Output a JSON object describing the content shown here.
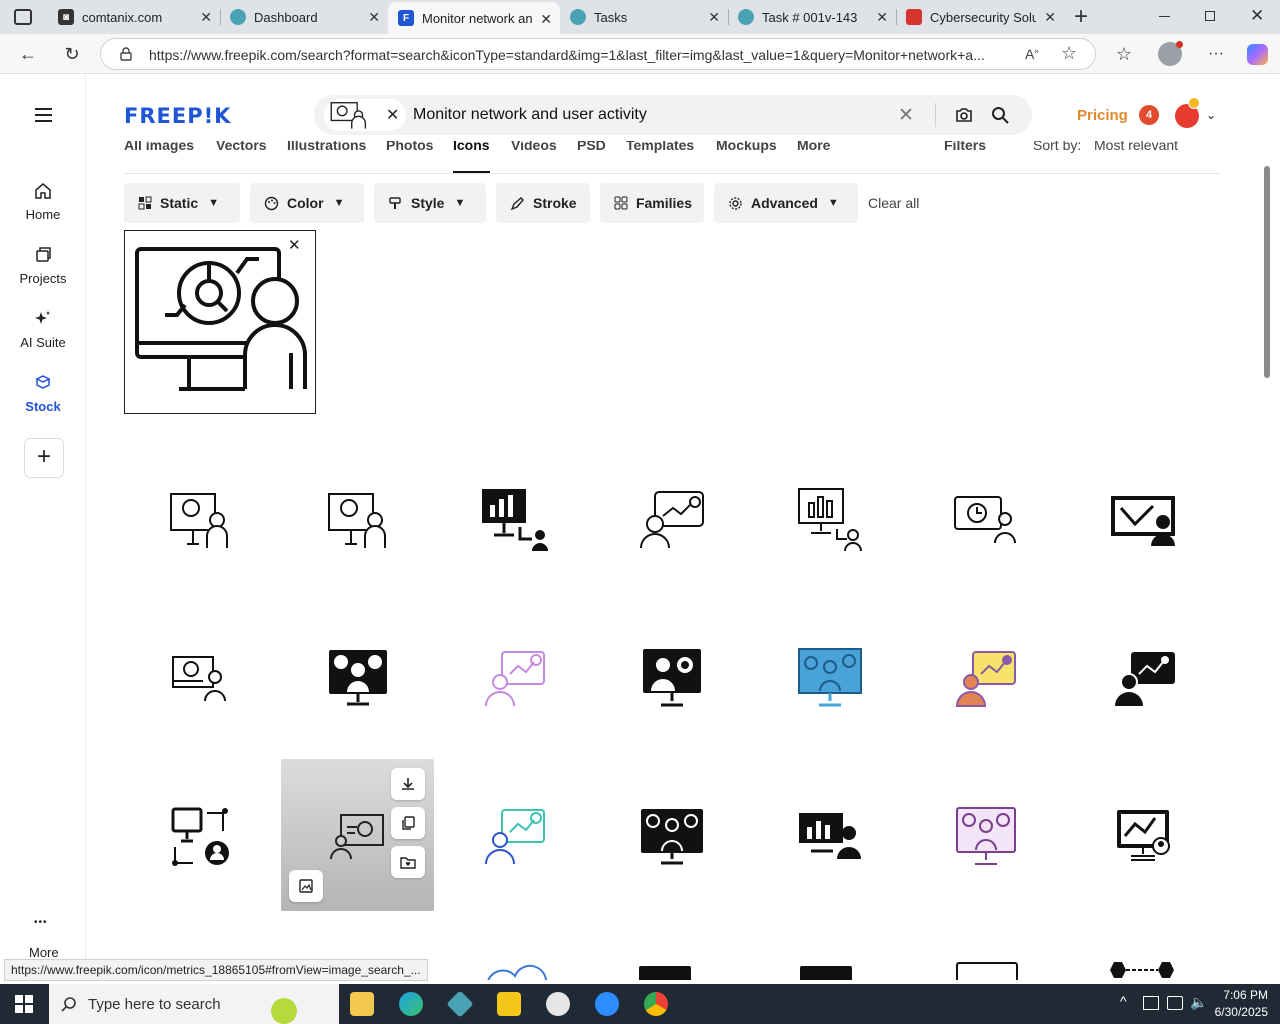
{
  "browser": {
    "tabs": [
      {
        "title": "comtanix.com"
      },
      {
        "title": "Dashboard"
      },
      {
        "title": "Monitor network and user activity"
      },
      {
        "title": "Tasks"
      },
      {
        "title": "Task # 001v-143"
      },
      {
        "title": "Cybersecurity Solutions"
      }
    ],
    "new_tab": "+",
    "url": "https://www.freepik.com/search?format=search&iconType=standard&img=1&last_filter=img&last_value=1&query=Monitor+network+a..."
  },
  "rail": {
    "items": [
      {
        "label": "Home",
        "icon": "home-icon"
      },
      {
        "label": "Projects",
        "icon": "projects-icon"
      },
      {
        "label": "AI Suite",
        "icon": "sparkle-icon"
      },
      {
        "label": "Stock",
        "icon": "stock-icon"
      }
    ],
    "add": "+",
    "more": "More",
    "more_dots": "•••"
  },
  "header": {
    "logo": "FREEP!K",
    "search_query": "Monitor network and user activity",
    "pricing": "Pricing",
    "notification_count": "4"
  },
  "categories": {
    "items": [
      "All images",
      "Vectors",
      "Illustrations",
      "Photos",
      "Icons",
      "Videos",
      "PSD",
      "Templates",
      "Mockups",
      "More"
    ],
    "selected": "Icons",
    "filters": "Filters",
    "sort_label": "Sort by:",
    "sort_value": "Most relevant"
  },
  "filters": {
    "chips": [
      "Static",
      "Color",
      "Style",
      "Stroke",
      "Families",
      "Advanced"
    ],
    "clear_all": "Clear all"
  },
  "colors": {
    "brand": "#1f56d6",
    "pricing": "#e0892e",
    "chip_bg": "#f1f2f4",
    "taskbar": "#1f2a35"
  },
  "status_url": "https://www.freepik.com/icon/metrics_18865105#fromView=image_search_...",
  "taskbar": {
    "search_placeholder": "Type here to search",
    "time": "7:06 PM",
    "date": "6/30/2025"
  }
}
